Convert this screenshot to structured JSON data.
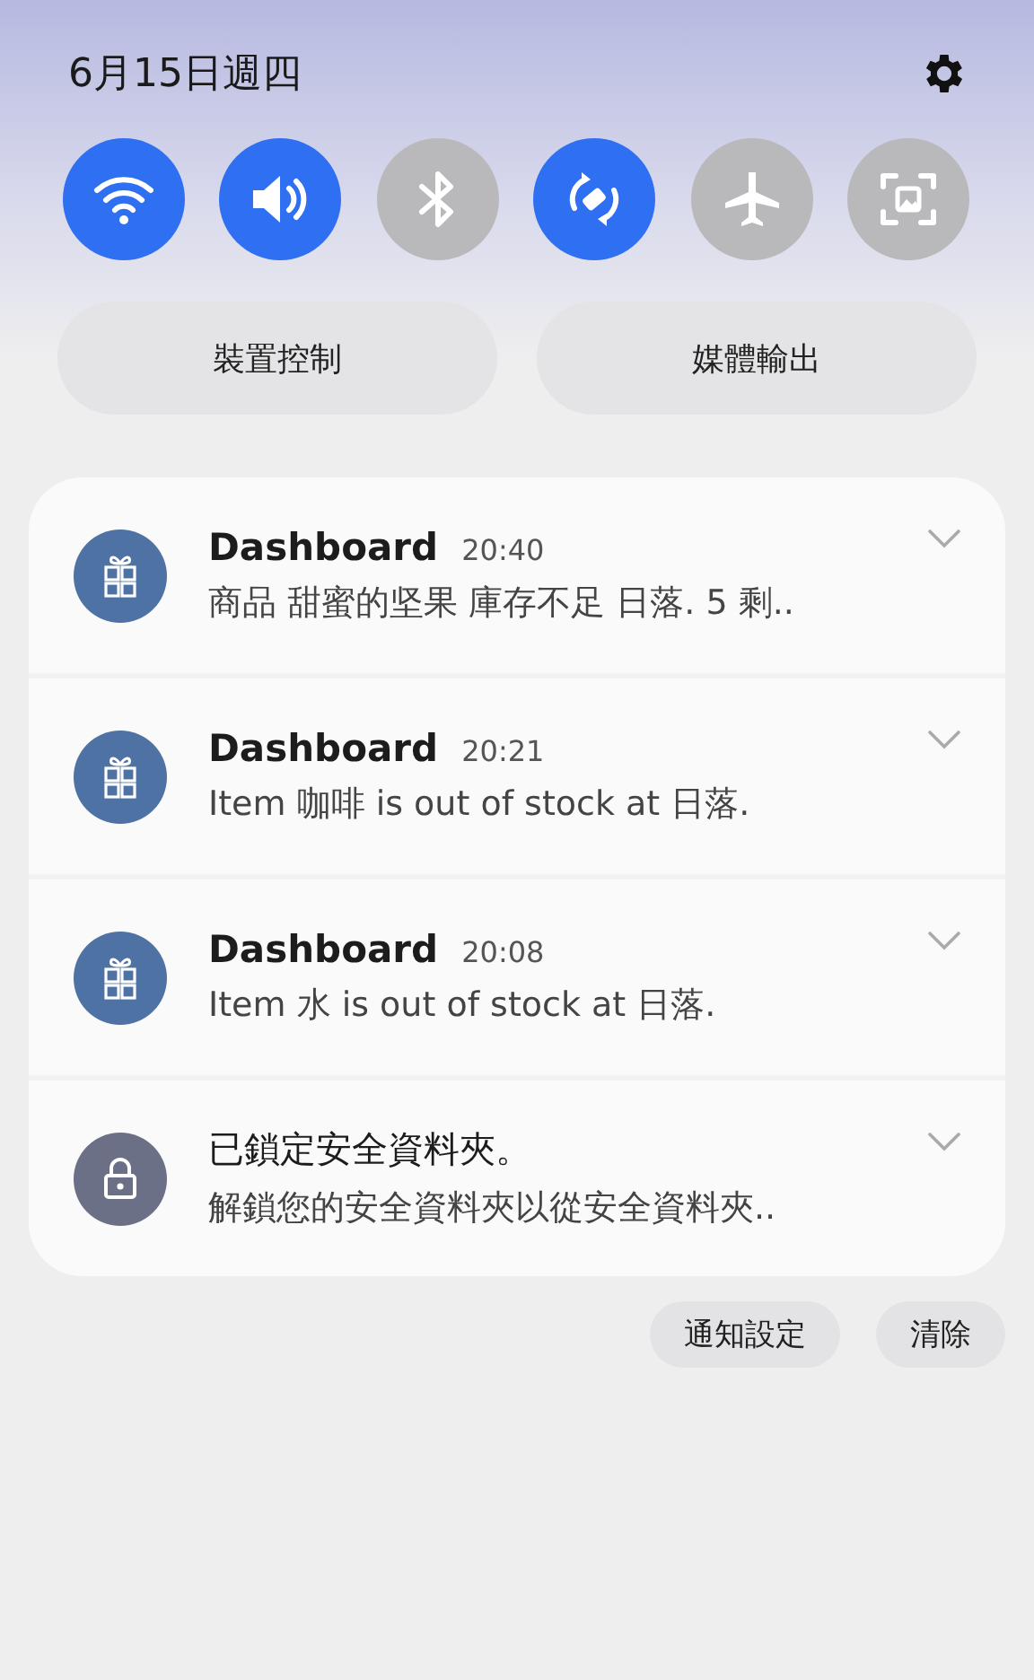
{
  "header": {
    "date": "6月15日週四"
  },
  "toggles": [
    {
      "kind": "wifi",
      "on": true
    },
    {
      "kind": "sound",
      "on": true
    },
    {
      "kind": "bluetooth",
      "on": false
    },
    {
      "kind": "rotate",
      "on": true
    },
    {
      "kind": "airplane",
      "on": false
    },
    {
      "kind": "screenshot",
      "on": false
    }
  ],
  "panel_buttons": [
    "裝置控制",
    "媒體輸出"
  ],
  "notifications": [
    {
      "kind": "app",
      "title": "Dashboard",
      "time": "20:40",
      "text": "商品 甜蜜的坚果 庫存不足 日落. 5 剩.."
    },
    {
      "kind": "app",
      "title": "Dashboard",
      "time": "20:21",
      "text": "Item 咖啡 is out of stock at 日落."
    },
    {
      "kind": "app",
      "title": "Dashboard",
      "time": "20:08",
      "text": "Item 水 is out of stock at 日落."
    },
    {
      "kind": "lock",
      "title": "已鎖定安全資料夾。",
      "text": "解鎖您的安全資料夾以從安全資料夾.."
    }
  ],
  "footer_buttons": [
    "通知設定",
    "清除"
  ]
}
